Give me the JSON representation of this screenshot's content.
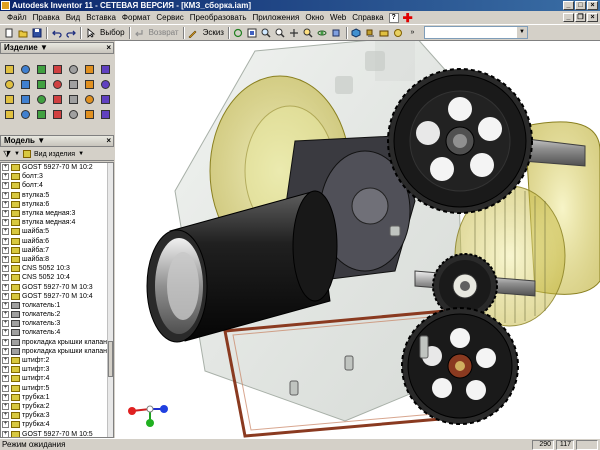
{
  "window": {
    "title": "Autodesk Inventor 11 - СЕТЕВАЯ ВЕРСИЯ - [КМЗ_сборка.iam]"
  },
  "menu": {
    "items": [
      "Файл",
      "Правка",
      "Вид",
      "Вставка",
      "Формат",
      "Сервис",
      "Преобразовать",
      "Приложения",
      "Окно",
      "Web",
      "Справка"
    ],
    "help_icon": "?"
  },
  "toolbar": {
    "select_label": "Выбор",
    "return_label": "Возврат",
    "sketch_label": "Эскиз"
  },
  "panels": {
    "tools_title": "Изделие",
    "browser_title": "Модель",
    "view_label": "Вид изделия"
  },
  "tree": {
    "items": [
      {
        "label": "GOST 5927-70 M 10:2",
        "icon": "part-yellow"
      },
      {
        "label": "болт:3",
        "icon": "part-yellow"
      },
      {
        "label": "болт:4",
        "icon": "part-yellow"
      },
      {
        "label": "втулка:5",
        "icon": "part-yellow"
      },
      {
        "label": "втулка:6",
        "icon": "part-yellow"
      },
      {
        "label": "втулка медная:3",
        "icon": "part-yellow"
      },
      {
        "label": "втулка медная:4",
        "icon": "part-yellow"
      },
      {
        "label": "шайба:5",
        "icon": "part-yellow"
      },
      {
        "label": "шайба:6",
        "icon": "part-yellow"
      },
      {
        "label": "шайба:7",
        "icon": "part-yellow"
      },
      {
        "label": "шайба:8",
        "icon": "part-yellow"
      },
      {
        "label": "CNS 5052 10:3",
        "icon": "part-yellow"
      },
      {
        "label": "CNS 5052 10:4",
        "icon": "part-yellow"
      },
      {
        "label": "GOST 5927-70 M 10:3",
        "icon": "part-yellow"
      },
      {
        "label": "GOST 5927-70 M 10:4",
        "icon": "part-yellow"
      },
      {
        "label": "толкатель:1",
        "icon": "part-gray"
      },
      {
        "label": "толкатель:2",
        "icon": "part-gray"
      },
      {
        "label": "толкатель:3",
        "icon": "part-gray"
      },
      {
        "label": "толкатель:4",
        "icon": "part-gray"
      },
      {
        "label": "прокладка крышки клапан",
        "icon": "part-gray"
      },
      {
        "label": "прокладка крышки клапан",
        "icon": "part-gray"
      },
      {
        "label": "штифт:2",
        "icon": "part-yellow"
      },
      {
        "label": "штифт:3",
        "icon": "part-yellow"
      },
      {
        "label": "штифт:4",
        "icon": "part-yellow"
      },
      {
        "label": "штифт:5",
        "icon": "part-yellow"
      },
      {
        "label": "трубка:1",
        "icon": "part-yellow"
      },
      {
        "label": "трубка:2",
        "icon": "part-yellow"
      },
      {
        "label": "трубка:3",
        "icon": "part-yellow"
      },
      {
        "label": "трубка:4",
        "icon": "part-yellow"
      },
      {
        "label": "GOST 5927-70 M 10:5",
        "icon": "part-yellow"
      }
    ]
  },
  "status": {
    "message": "Режим ожидания",
    "value_1": "290",
    "value_2": "117"
  },
  "colors": {
    "title_bar": "#0a246a",
    "gear": "#1a1a1a",
    "housing_yellow": "#c8c040",
    "gasket": "#8a3a20"
  }
}
